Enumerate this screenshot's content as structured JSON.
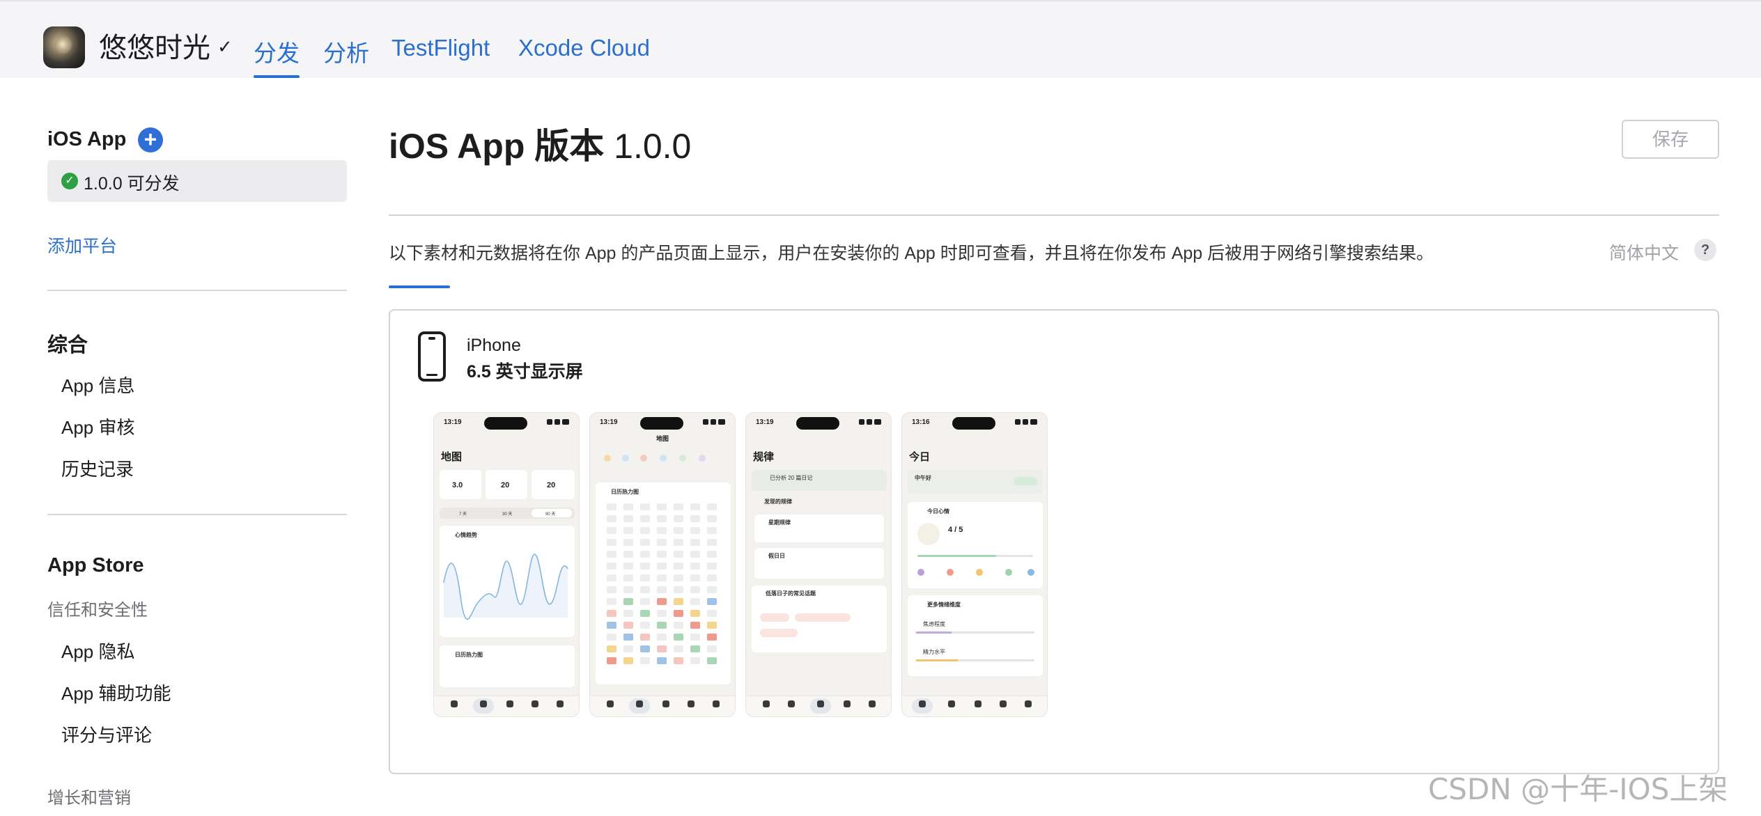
{
  "header": {
    "app_name": "悠悠时光",
    "chevron": "✓",
    "tabs": [
      {
        "label": "分发",
        "active": true
      },
      {
        "label": "分析",
        "active": false
      },
      {
        "label": "TestFlight",
        "active": false
      },
      {
        "label": "Xcode Cloud",
        "active": false
      }
    ]
  },
  "sidebar": {
    "ios_heading": "iOS App",
    "add_icon": "plus-icon",
    "version_label": "1.0.0 可分发",
    "add_platform": "添加平台",
    "general_heading": "综合",
    "general_items": [
      "App 信息",
      "App 审核",
      "历史记录"
    ],
    "store_heading": "App Store",
    "trust_heading": "信任和安全性",
    "trust_items": [
      "App 隐私",
      "App 辅助功能",
      "评分与评论"
    ],
    "growth_heading": "增长和营销"
  },
  "main": {
    "title_bold": "iOS App 版本",
    "title_version": " 1.0.0",
    "save_label": "保存",
    "description": "以下素材和元数据将在你 App 的产品页面上显示，用户在安装你的 App 时即可查看，并且将在你发布 App 后被用于网络引擎搜索结果。",
    "language": "简体中文",
    "help": "?",
    "device": {
      "icon": "iphone-icon",
      "name": "iPhone",
      "size": "6.5 英寸显示屏"
    }
  },
  "screenshots": [
    {
      "time": "13:19",
      "title": "地图",
      "stats": [
        "3.0",
        "20",
        "20"
      ],
      "ranges": [
        "7 天",
        "30 天",
        "90 天"
      ],
      "trend_title": "心情趋势",
      "heatmap_title": "日历热力图"
    },
    {
      "time": "13:19",
      "title": "地图",
      "heatmap_title": "日历热力图"
    },
    {
      "time": "13:19",
      "title": "规律",
      "banner": "已分析 20 篇日记",
      "section1": "发现的规律",
      "item1": "星期规律",
      "item2": "假日日",
      "section2": "低落日子的常见话题"
    },
    {
      "time": "13:16",
      "title": "今日",
      "greeting": "中午好",
      "mood_title": "今日心情",
      "mood_score": "4 / 5",
      "more_title": "更多情绪维度",
      "dim1": "焦虑程度",
      "dim2": "精力水平"
    }
  ],
  "watermark": "CSDN @十年-IOS上架",
  "colors": {
    "accent": "#2a6fce",
    "success": "#2ea043",
    "plus": "#2f6fd6"
  }
}
